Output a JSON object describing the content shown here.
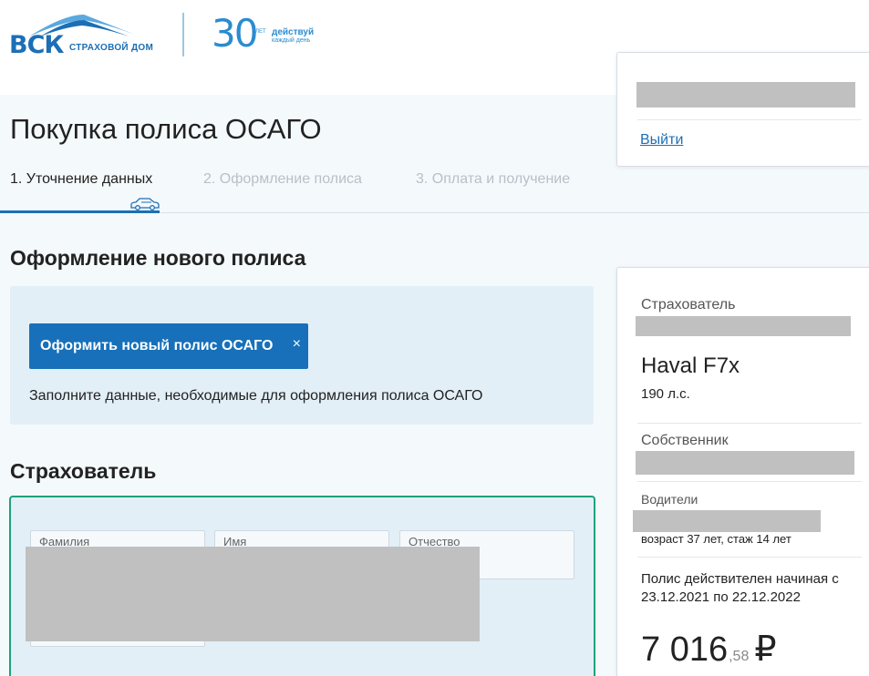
{
  "brand": {
    "logo_text": "ВСК",
    "logo_subtitle": "СТРАХОВОЙ ДОМ",
    "anniversary_number": "30",
    "anniversary_let": "ЛЕТ",
    "anniversary_word": "действуй",
    "anniversary_sub": "каждый день",
    "accent_color": "#1c6fb5"
  },
  "user_panel": {
    "logout_label": "Выйти"
  },
  "page": {
    "title": "Покупка полиса ОСАГО"
  },
  "steps": [
    {
      "label": "1. Уточнение данных",
      "active": true
    },
    {
      "label": "2. Оформление полиса",
      "active": false
    },
    {
      "label": "3. Оплата и получение",
      "active": false
    }
  ],
  "new_policy": {
    "section_title": "Оформление нового полиса",
    "button_label": "Оформить новый полис ОСАГО",
    "button_close_glyph": "×",
    "description": "Заполните данные, необходимые для оформления полиса ОСАГО"
  },
  "insurer_form": {
    "title": "Страхователь",
    "fields": [
      {
        "label": "Фамилия"
      },
      {
        "label": "Имя"
      },
      {
        "label": "Отчество"
      }
    ]
  },
  "summary": {
    "insurer_label": "Страхователь",
    "car_name": "Haval F7x",
    "car_power": "190 л.с.",
    "owner_label": "Собственник",
    "drivers_label": "Водители",
    "driver_info": "возраст 37 лет, стаж 14 лет",
    "validity": "Полис действителен начиная с 23.12.2021 по 22.12.2022",
    "price_int": "7 016",
    "price_frac": ",58",
    "currency": "₽"
  }
}
